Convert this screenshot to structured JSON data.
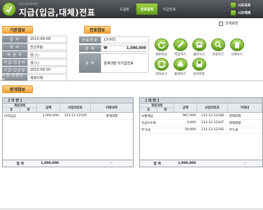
{
  "header": {
    "subtitle": "업무자동화엑셀",
    "title": "지급(입금,대체)전표",
    "nav_tabs": [
      {
        "label": "도움말",
        "active": false
      },
      {
        "label": "전표입력",
        "active": true
      },
      {
        "label": "지급전표",
        "active": false
      }
    ],
    "side_buttons": [
      {
        "label": "시트보호"
      },
      {
        "label": "시트해제"
      }
    ],
    "accent_color": "#7cc02a"
  },
  "basic_info": {
    "section_title": "기본정보",
    "fields": [
      {
        "label": "일  자",
        "value": "2013-09-09"
      },
      {
        "label": "부  서",
        "value": "전산조팀"
      },
      {
        "label": "작 성 자",
        "value": "김○○"
      },
      {
        "label": "지급/입금자",
        "value": "김○○"
      },
      {
        "label": "지급/입금일",
        "value": "2013-09-10"
      },
      {
        "label": "지급/입금방법",
        "value": "계좌이체"
      }
    ]
  },
  "voucher_info": {
    "section_title": "전표정보",
    "number_label": "전표번호",
    "number_value": "13-001",
    "amount_label": "금  액",
    "amount_currency": "₩",
    "amount_value": "1,000,000",
    "memo_label": "내  역",
    "memo_value": "경제대행 미지급전표"
  },
  "actions": [
    {
      "label": "새로작성",
      "icon": "refresh-icon"
    },
    {
      "label": "저장하기",
      "icon": "pencil-icon"
    },
    {
      "label": "불러오기",
      "icon": "load-icon"
    },
    {
      "label": "수정하기",
      "icon": "edit-icon"
    },
    {
      "label": "삭제하기",
      "icon": "trash-icon"
    },
    {
      "label": "미리보기",
      "icon": "preview-icon"
    },
    {
      "label": "출력하기",
      "icon": "print-icon"
    },
    {
      "label": "문서저장",
      "icon": "save-icon"
    }
  ],
  "full_screen_label": "전체화면",
  "split_info": {
    "section_title": "분개정보",
    "debit": {
      "title": "[ 차    변 ]",
      "header": {
        "account": "계정과목",
        "sub_left": "과",
        "sub_right": "목",
        "amount": "금액",
        "bizno": "사업자번호",
        "desc": "거래내역"
      },
      "rows": [
        {
          "account": "미지급금",
          "amount": "1,000,000",
          "bizno": "123-12-12345",
          "desc": "경제대행"
        }
      ],
      "total_label": "합    계",
      "total_amount": "1,000,000",
      "total_dash": "-"
    },
    "credit": {
      "title": "[ 대    변 ]",
      "header": {
        "account": "계정과목",
        "sub_left": "과",
        "sub_right": "목",
        "amount": "금액",
        "bizno": "사업자번호",
        "desc": "거래내"
      },
      "rows": [
        {
          "account": "보통예금",
          "amount": "967,000",
          "bizno": "123-12-12346",
          "desc": "경제대행"
        },
        {
          "account": "지급수수료",
          "amount": "3,000",
          "bizno": "123-12-12347",
          "desc": "경제대행"
        },
        {
          "account": "부가세",
          "amount": "30,000",
          "bizno": "123-12-12345",
          "desc": "부가세"
        }
      ],
      "total_label": "합    계",
      "total_amount": "1,000,000",
      "total_dash": "-"
    }
  }
}
